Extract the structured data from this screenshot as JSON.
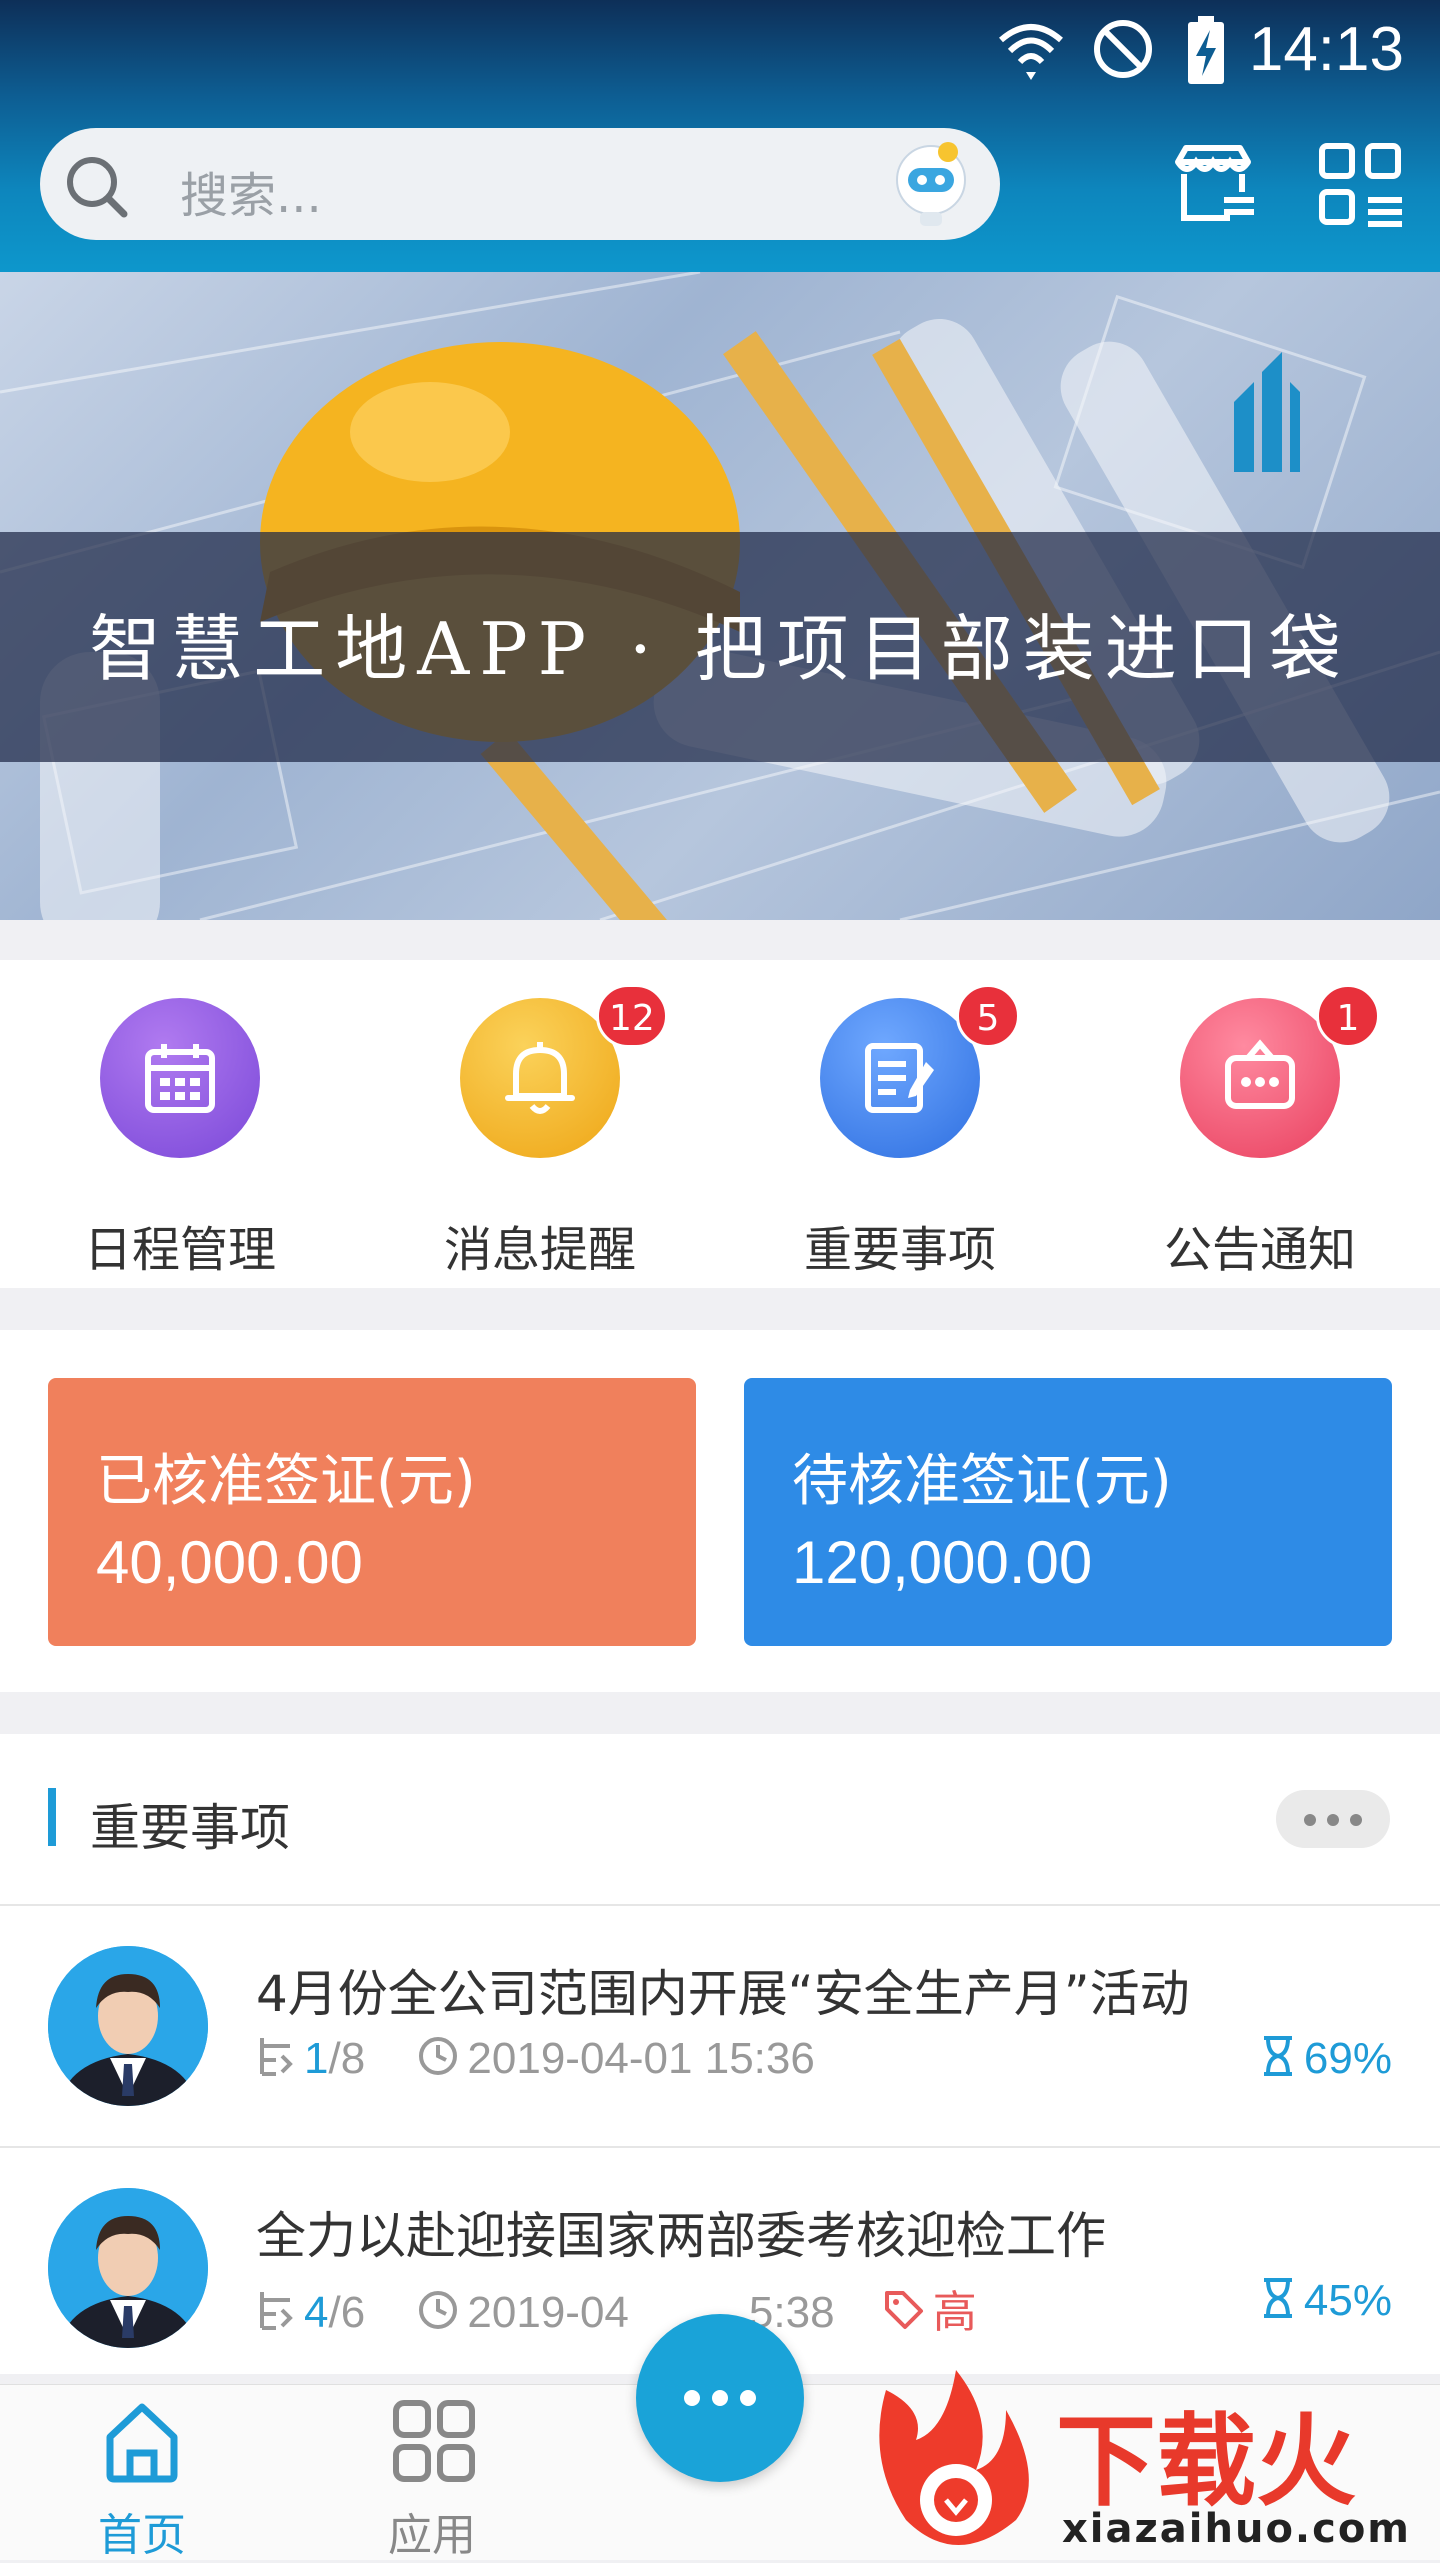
{
  "status_bar": {
    "time": "14:13"
  },
  "header": {
    "search_placeholder": "搜索..."
  },
  "banner": {
    "slogan": "智慧工地APP · 把项目部装进口袋"
  },
  "quick_entries": [
    {
      "label": "日程管理",
      "badge": "",
      "color": "#8a5be0"
    },
    {
      "label": "消息提醒",
      "badge": "12",
      "color": "#f2b320"
    },
    {
      "label": "重要事项",
      "badge": "5",
      "color": "#3c7be6"
    },
    {
      "label": "公告通知",
      "badge": "1",
      "color": "#ef4d6a"
    }
  ],
  "stats": {
    "approved": {
      "title": "已核准签证(元)",
      "value": "40,000.00",
      "color": "#f0805c"
    },
    "pending": {
      "title": "待核准签证(元)",
      "value": "120,000.00",
      "color": "#2e8be6"
    }
  },
  "important": {
    "title": "重要事项",
    "items": [
      {
        "title": "4月份全公司范围内开展“安全生产月”活动",
        "done": "1",
        "total": "/8",
        "time": "2019-04-01 15:36",
        "priority": "",
        "progress": "69%"
      },
      {
        "title": "全力以赴迎接国家两部委考核迎检工作",
        "done": "4",
        "total": "/6",
        "time": "2019-04",
        "time_tail": "5:38",
        "priority": "高",
        "progress": "45%"
      }
    ]
  },
  "nav": {
    "items": [
      {
        "label": "首页",
        "active": true
      },
      {
        "label": "应用",
        "active": false
      }
    ]
  },
  "watermark": {
    "text": "下载火",
    "url": "xiazaihuo.com"
  }
}
